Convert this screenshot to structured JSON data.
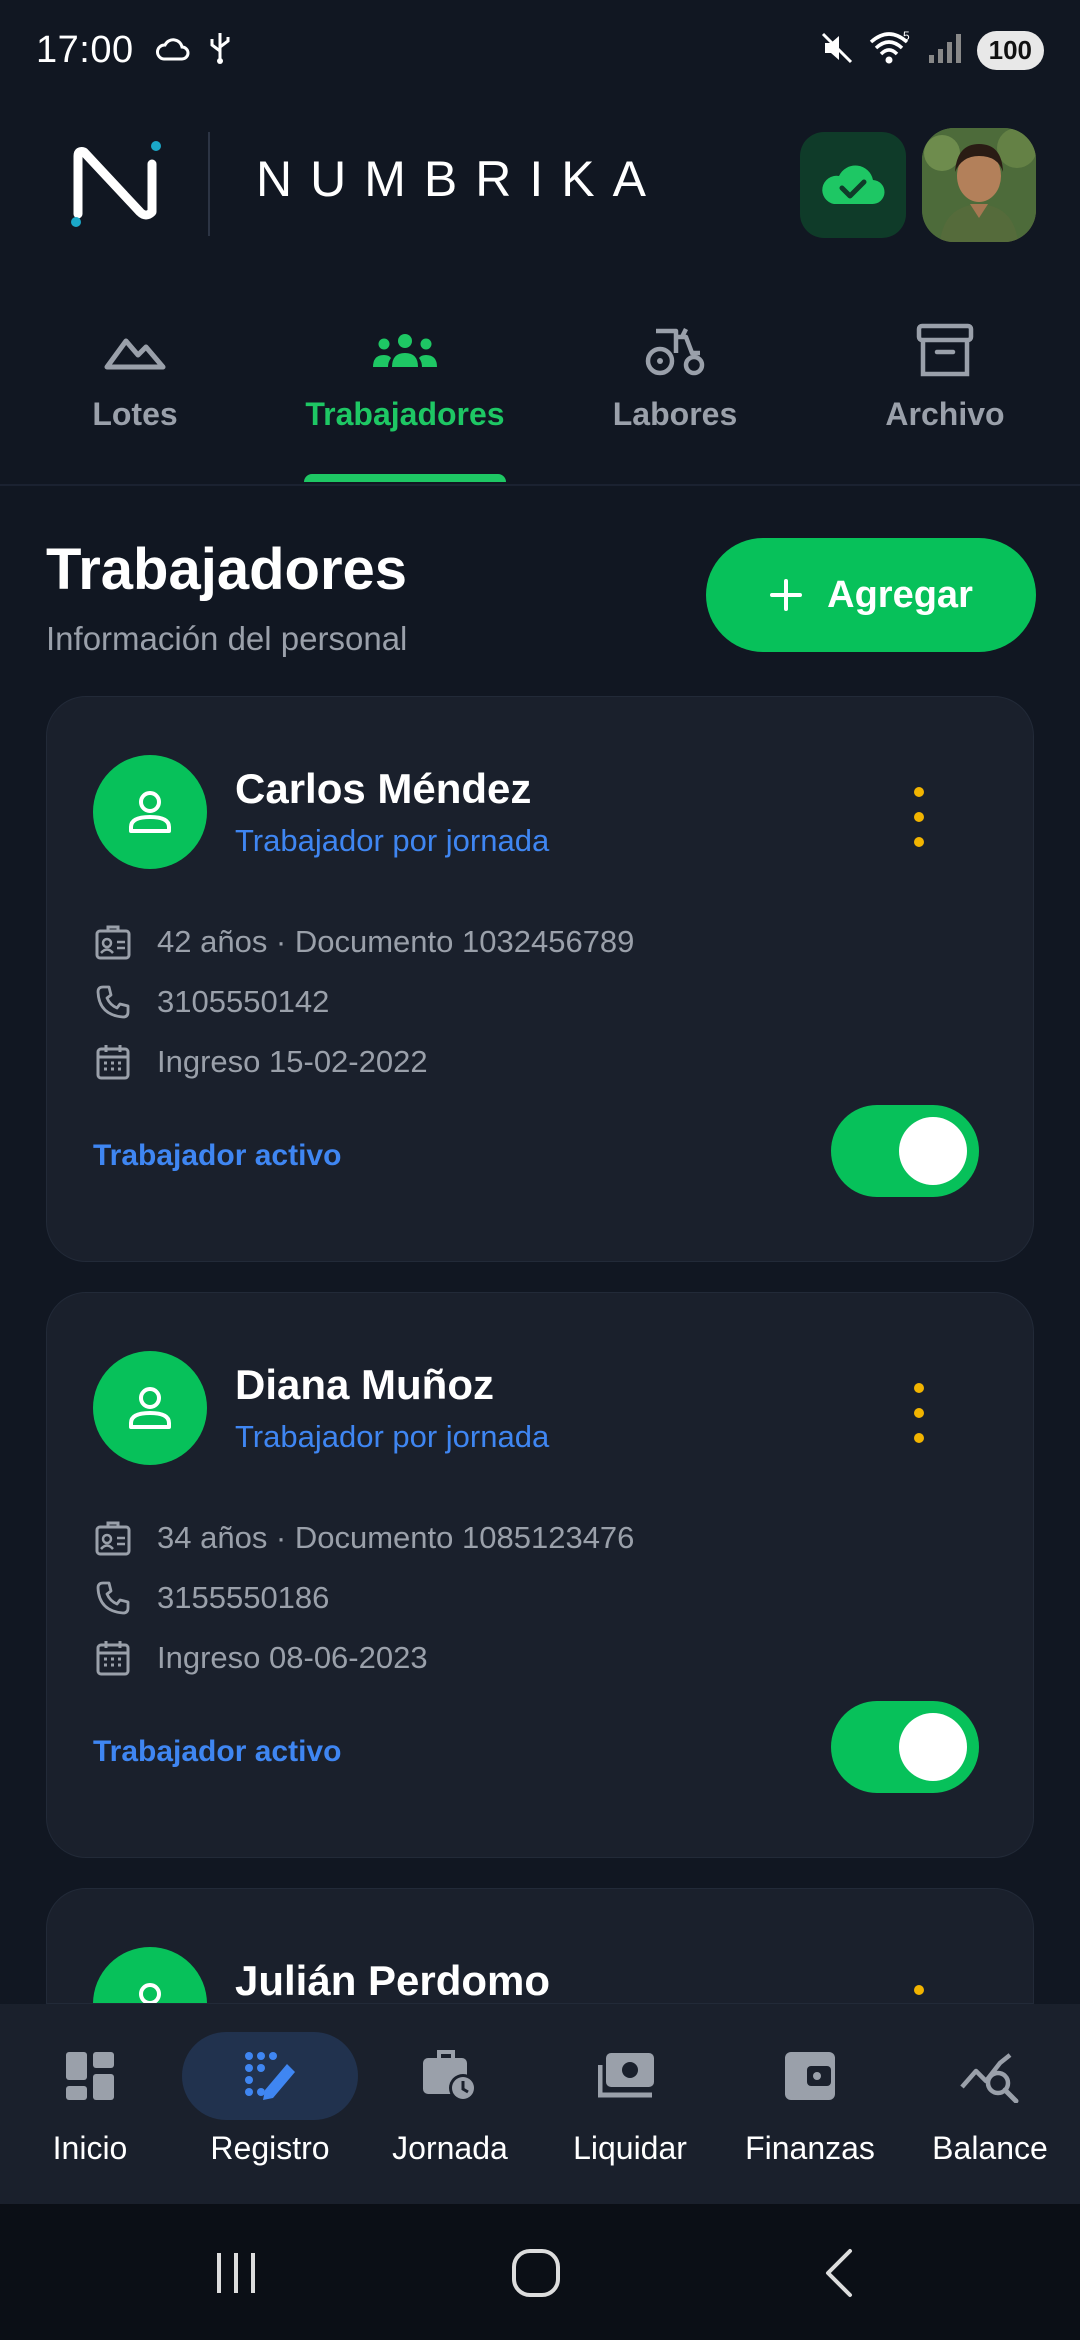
{
  "status_bar": {
    "time": "17:00",
    "battery": "100",
    "wifi_badge": "5"
  },
  "header": {
    "brand": "NUMBRIKA"
  },
  "tabs": [
    {
      "label": "Lotes",
      "icon": "mountain-icon"
    },
    {
      "label": "Trabajadores",
      "icon": "people-icon",
      "active": true
    },
    {
      "label": "Labores",
      "icon": "tractor-icon"
    },
    {
      "label": "Archivo",
      "icon": "archive-icon"
    }
  ],
  "page": {
    "title": "Trabajadores",
    "subtitle": "Información del personal",
    "add_label": "Agregar"
  },
  "workers": [
    {
      "name": "Carlos Méndez",
      "role": "Trabajador por jornada",
      "details": "42 años · Documento 1032456789",
      "phone": "3105550142",
      "start": "Ingreso 15-02-2022",
      "status": "Trabajador activo",
      "active": true
    },
    {
      "name": "Diana Muñoz",
      "role": "Trabajador por jornada",
      "details": "34 años · Documento 1085123476",
      "phone": "3155550186",
      "start": "Ingreso 08-06-2023",
      "status": "Trabajador activo",
      "active": true
    },
    {
      "name": "Julián Perdomo"
    }
  ],
  "bottom_nav": [
    {
      "label": "Inicio",
      "icon": "dashboard-icon"
    },
    {
      "label": "Registro",
      "icon": "edit-grid-icon",
      "active": true
    },
    {
      "label": "Jornada",
      "icon": "briefcase-clock-icon"
    },
    {
      "label": "Liquidar",
      "icon": "payment-icon"
    },
    {
      "label": "Finanzas",
      "icon": "wallet-icon"
    },
    {
      "label": "Balance",
      "icon": "chart-search-icon"
    }
  ],
  "colors": {
    "background": "#111722",
    "card": "#1a202c",
    "accent_green": "#07c15a",
    "link_blue": "#3f86f2",
    "menu_dot_yellow": "#f2b400",
    "muted_text": "#9aa0aa"
  }
}
